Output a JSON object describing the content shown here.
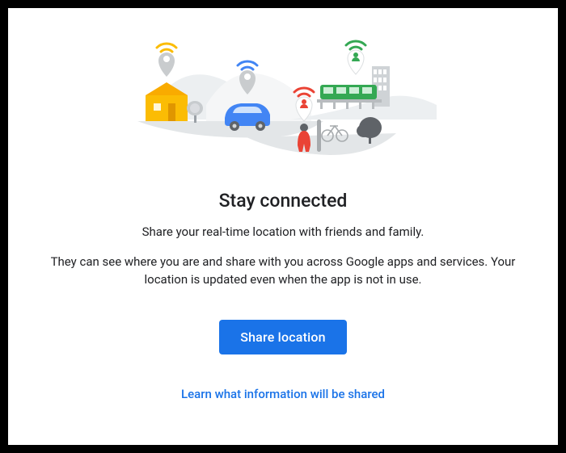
{
  "heading": "Stay connected",
  "subhead": "Share your real-time location with friends and family.",
  "description": "They can see where you are and share with you across Google apps and services. Your location is updated even when the app is not in use.",
  "buttons": {
    "share_label": "Share location",
    "learn_label": "Learn what information will be shared"
  },
  "colors": {
    "primary": "#1a73e8",
    "yellow": "#fbbc04",
    "green": "#34a853",
    "red": "#ea4335",
    "blue": "#4285f4"
  }
}
